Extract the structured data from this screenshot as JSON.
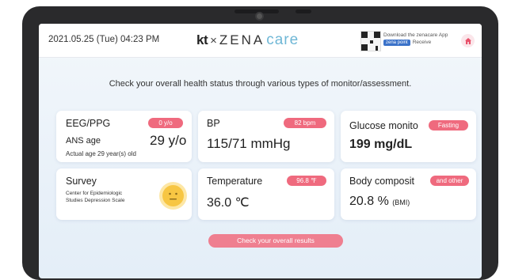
{
  "header": {
    "datetime": "2021.05.25 (Tue) 04:23 PM",
    "brand": {
      "kt": "kt",
      "times": "×",
      "zena": "ZENA",
      "care": "care"
    },
    "download": {
      "line1": "Download the zenacare App",
      "chip": "zena point",
      "line2_rest": "Receive"
    }
  },
  "intro": "Check your overall health status through various types of monitor/assessment.",
  "cards": {
    "eeg": {
      "title": "EEG/PPG",
      "badge": "0 y/o",
      "label": "ANS age",
      "value": "29 y/o",
      "note": "Actual age 29 year(s) old"
    },
    "bp": {
      "title": "BP",
      "badge": "82 bpm",
      "value": "115/71 mmHg"
    },
    "glucose": {
      "title": "Glucose monito",
      "badge": "Fasting",
      "value": "199 mg/dL"
    },
    "survey": {
      "title": "Survey",
      "line1": "Center for Epidemiologic",
      "line2": "Studies Depression Scale"
    },
    "temperature": {
      "title": "Temperature",
      "badge": "96.8 ℉",
      "value": "36.0 ℃"
    },
    "body": {
      "title": "Body composit",
      "badge": "and other",
      "value": "20.8 %",
      "unit": "(BMI)"
    }
  },
  "cta": "Check your overall results",
  "colors": {
    "accent": "#ef6a7e",
    "brand": "#6fb7d6",
    "link": "#3b72c9"
  }
}
